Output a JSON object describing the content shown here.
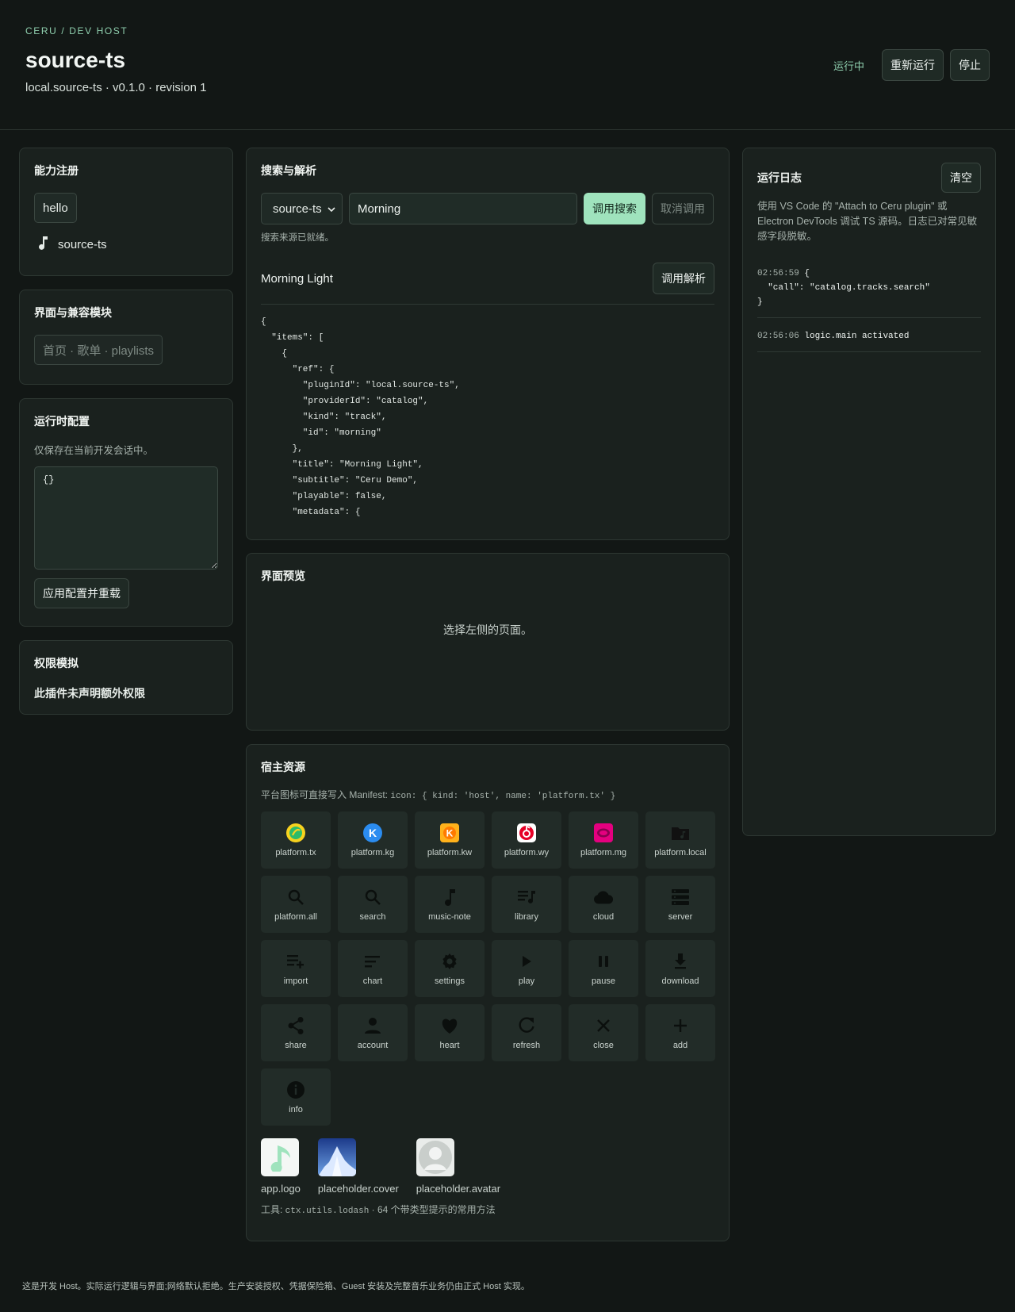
{
  "header": {
    "eyebrow": "CERU / DEV HOST",
    "title": "source-ts",
    "subtitle": "local.source-ts · v0.1.0 · revision 1",
    "status": "运行中",
    "rerun_label": "重新运行",
    "stop_label": "停止"
  },
  "capabilities": {
    "title": "能力注册",
    "chip": "hello",
    "item_label": "source-ts"
  },
  "ui_modules": {
    "title": "界面与兼容模块",
    "chip": "首页 · 歌单 · playlists"
  },
  "runtime_config": {
    "title": "运行时配置",
    "hint": "仅保存在当前开发会话中。",
    "value": "{}",
    "apply_label": "应用配置并重载"
  },
  "permissions": {
    "title": "权限模拟",
    "text": "此插件未声明额外权限"
  },
  "search": {
    "title": "搜索与解析",
    "source_value": "source-ts",
    "query_value": "Morning",
    "search_label": "调用搜索",
    "cancel_label": "取消调用",
    "status": "搜索来源已就绪。",
    "result_title": "Morning Light",
    "resolve_label": "调用解析",
    "json": "{\n  \"items\": [\n    {\n      \"ref\": {\n        \"pluginId\": \"local.source-ts\",\n        \"providerId\": \"catalog\",\n        \"kind\": \"track\",\n        \"id\": \"morning\"\n      },\n      \"title\": \"Morning Light\",\n      \"subtitle\": \"Ceru Demo\",\n      \"playable\": false,\n      \"metadata\": {"
  },
  "preview": {
    "title": "界面预览",
    "empty": "选择左侧的页面。"
  },
  "host_resources": {
    "title": "宿主资源",
    "hint_prefix": "平台图标可直接写入 Manifest: ",
    "hint_code": "icon: { kind: 'host', name: 'platform.tx' }",
    "icons": [
      {
        "label": "platform.tx",
        "icon": "platform-tx-icon"
      },
      {
        "label": "platform.kg",
        "icon": "platform-kg-icon"
      },
      {
        "label": "platform.kw",
        "icon": "platform-kw-icon"
      },
      {
        "label": "platform.wy",
        "icon": "platform-wy-icon"
      },
      {
        "label": "platform.mg",
        "icon": "platform-mg-icon"
      },
      {
        "label": "platform.local",
        "icon": "platform-local-icon"
      },
      {
        "label": "platform.all",
        "icon": "search-icon"
      },
      {
        "label": "search",
        "icon": "search-icon"
      },
      {
        "label": "music-note",
        "icon": "music-note-icon"
      },
      {
        "label": "library",
        "icon": "library-icon"
      },
      {
        "label": "cloud",
        "icon": "cloud-icon"
      },
      {
        "label": "server",
        "icon": "server-icon"
      },
      {
        "label": "import",
        "icon": "import-icon"
      },
      {
        "label": "chart",
        "icon": "chart-icon"
      },
      {
        "label": "settings",
        "icon": "settings-icon"
      },
      {
        "label": "play",
        "icon": "play-icon"
      },
      {
        "label": "pause",
        "icon": "pause-icon"
      },
      {
        "label": "download",
        "icon": "download-icon"
      },
      {
        "label": "share",
        "icon": "share-icon"
      },
      {
        "label": "account",
        "icon": "account-icon"
      },
      {
        "label": "heart",
        "icon": "heart-icon"
      },
      {
        "label": "refresh",
        "icon": "refresh-icon"
      },
      {
        "label": "close",
        "icon": "close-icon"
      },
      {
        "label": "add",
        "icon": "add-icon"
      },
      {
        "label": "info",
        "icon": "info-icon"
      }
    ],
    "assets": [
      {
        "label": "app.logo"
      },
      {
        "label": "placeholder.cover"
      },
      {
        "label": "placeholder.avatar"
      }
    ],
    "tools_prefix": "工具: ",
    "tools_code": "ctx.utils.lodash",
    "tools_suffix": " · 64 个带类型提示的常用方法"
  },
  "log": {
    "title": "运行日志",
    "clear_label": "清空",
    "hint": "使用 VS Code 的 \"Attach to Ceru plugin\" 或 Electron DevTools 调试 TS 源码。日志已对常见敏感字段脱敏。",
    "entries": [
      {
        "time": "02:56:59",
        "message": "{\n  \"call\": \"catalog.tracks.search\"\n}"
      },
      {
        "time": "02:56:06",
        "message": "logic.main activated"
      }
    ]
  },
  "footer": "这是开发 Host。实际运行逻辑与界面;网络默认拒绝。生产安装授权、凭据保险箱、Guest 安装及完整音乐业务仍由正式 Host 实现。",
  "colors": {
    "background": "#121715",
    "panel": "#1a211e",
    "accent": "#9fe3bd",
    "status": "#8fcfae"
  }
}
